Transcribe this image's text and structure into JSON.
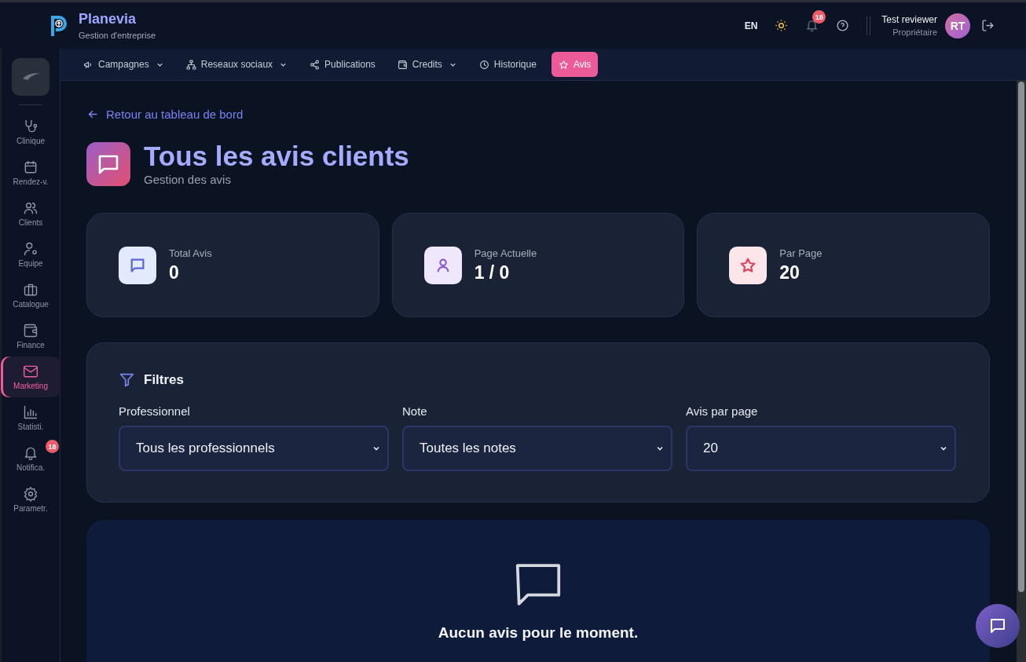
{
  "header": {
    "app_name": "Planevia",
    "tagline": "Gestion d'entreprise",
    "language": "EN",
    "notification_count": "18",
    "user_name": "Test reviewer",
    "user_role": "Propriétaire",
    "avatar_initials": "RT"
  },
  "sidebar": {
    "items": [
      {
        "label": "Clinique",
        "selected": false
      },
      {
        "label": "Rendez-v.",
        "selected": false
      },
      {
        "label": "Clients",
        "selected": false
      },
      {
        "label": "Equipe",
        "selected": false
      },
      {
        "label": "Catalogue",
        "selected": false
      },
      {
        "label": "Finance",
        "selected": false
      },
      {
        "label": "Marketing",
        "selected": true
      },
      {
        "label": "Statisti.",
        "selected": false
      },
      {
        "label": "Notifica.",
        "selected": false,
        "badge": "18"
      },
      {
        "label": "Parametr.",
        "selected": false
      }
    ]
  },
  "tabs": [
    {
      "label": "Campagnes",
      "selected": false,
      "has_menu": true
    },
    {
      "label": "Reseaux sociaux",
      "selected": false,
      "has_menu": true
    },
    {
      "label": "Publications",
      "selected": false,
      "has_menu": false
    },
    {
      "label": "Credits",
      "selected": false,
      "has_menu": true
    },
    {
      "label": "Historique",
      "selected": false,
      "has_menu": false
    },
    {
      "label": "Avis",
      "selected": true,
      "has_menu": false
    }
  ],
  "back_link": "Retour au tableau de bord",
  "page": {
    "title": "Tous les avis clients",
    "subtitle": "Gestion des avis"
  },
  "stats": [
    {
      "label": "Total Avis",
      "value": "0",
      "color": "#5b63d8"
    },
    {
      "label": "Page Actuelle",
      "value": "1 / 0",
      "color": "#8b5cd6"
    },
    {
      "label": "Par Page",
      "value": "20",
      "color": "#e0455f"
    }
  ],
  "filters": {
    "title": "Filtres",
    "fields": [
      {
        "label": "Professionnel",
        "value": "Tous les professionnels"
      },
      {
        "label": "Note",
        "value": "Toutes les notes"
      },
      {
        "label": "Avis par page",
        "value": "20"
      }
    ]
  },
  "empty_state": {
    "message": "Aucun avis pour le moment."
  }
}
